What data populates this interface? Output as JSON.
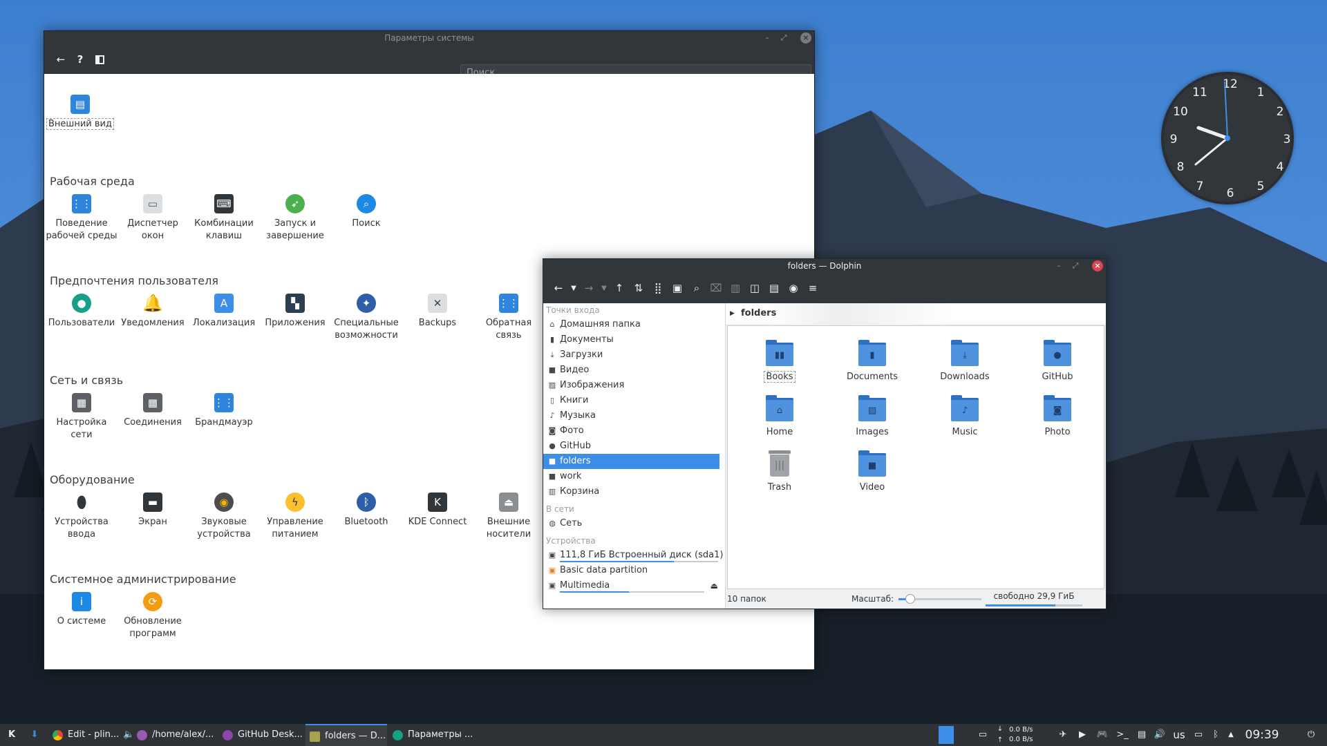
{
  "settings_window": {
    "title": "Параметры системы",
    "search_placeholder": "Поиск",
    "top_item": "Внешний вид",
    "categories": [
      {
        "title": "Рабочая среда",
        "items": [
          "Поведение рабочей среды",
          "Диспетчер окон",
          "Комбинации клавиш",
          "Запуск и завершение",
          "Поиск"
        ]
      },
      {
        "title": "Предпочтения пользователя",
        "items": [
          "Пользователи",
          "Уведомления",
          "Локализация",
          "Приложения",
          "Специальные возможности",
          "Backups",
          "Обратная связь"
        ]
      },
      {
        "title": "Сеть и связь",
        "items": [
          "Настройка сети",
          "Соединения",
          "Брандмауэр"
        ]
      },
      {
        "title": "Оборудование",
        "items": [
          "Устройства ввода",
          "Экран",
          "Звуковые устройства",
          "Управление питанием",
          "Bluetooth",
          "KDE Connect",
          "Внешние носители"
        ]
      },
      {
        "title": "Системное администрирование",
        "items": [
          "О системе",
          "Обновление программ"
        ]
      }
    ]
  },
  "dolphin": {
    "title": "folders — Dolphin",
    "places_header": "Точки входа",
    "places": [
      "Домашняя папка",
      "Документы",
      "Загрузки",
      "Видео",
      "Изображения",
      "Книги",
      "Музыка",
      "Фото",
      "GitHub",
      "folders",
      "work",
      "Корзина"
    ],
    "network_header": "В сети",
    "network": [
      "Сеть"
    ],
    "devices_header": "Устройства",
    "devices": [
      "111,8 ГиБ Встроенный диск (sda1)",
      "Basic data partition",
      "Multimedia"
    ],
    "breadcrumb": "folders",
    "folders": [
      "Books",
      "Documents",
      "Downloads",
      "GitHub",
      "Home",
      "Images",
      "Music",
      "Photo",
      "Trash",
      "Video"
    ],
    "status_count": "10 папок",
    "zoom_label": "Масштаб:",
    "free_space": "свободно 29,9 ГиБ"
  },
  "taskbar": {
    "tasks": [
      "Edit - plin...",
      "/home/alex/...",
      "GitHub Desk...",
      "folders — D...",
      "Параметры ..."
    ],
    "net_down": "0.0 B/s",
    "net_up": "0.0 B/s",
    "keyboard_layout": "us",
    "time": "09:39"
  },
  "colors": {
    "accent": "#3d8ee9",
    "panel": "#31363b",
    "folder": "#4f92de"
  }
}
